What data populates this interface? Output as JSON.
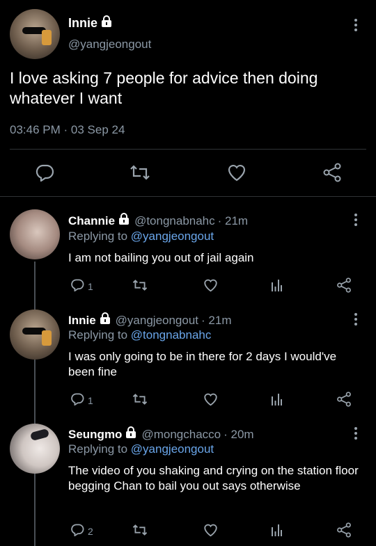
{
  "main_tweet": {
    "name": "Innie",
    "handle": "@yangjeongout",
    "text": "I love asking 7 people for advice then doing whatever I want",
    "time": "03:46 PM",
    "separator": "·",
    "date": "03 Sep 24"
  },
  "replies": [
    {
      "name": "Channie",
      "handle": "@tongnabnahc",
      "time": "· 21m",
      "replying_prefix": "Replying to",
      "replying_to": "@yangjeongout",
      "text": "I am not bailing you out of jail again",
      "reply_count": "1"
    },
    {
      "name": "Innie",
      "handle": "@yangjeongout",
      "time": "· 21m",
      "replying_prefix": "Replying to",
      "replying_to": "@tongnabnahc",
      "text": "I was only going to be in there for 2 days I would've been fine",
      "reply_count": "1"
    },
    {
      "name": "Seungmo",
      "handle": "@mongchacco",
      "time": "· 20m",
      "replying_prefix": "Replying to",
      "replying_to": "@yangjeongout",
      "text": "The video of you shaking and crying on the station floor begging Chan to bail you out says otherwise",
      "reply_count": "2"
    }
  ],
  "colors": {
    "background": "#000000",
    "link": "#6aa6ea",
    "muted": "#8b98a5"
  },
  "icons": [
    "lock-icon",
    "more-icon",
    "reply-icon",
    "retweet-icon",
    "like-icon",
    "analytics-icon",
    "share-icon"
  ]
}
